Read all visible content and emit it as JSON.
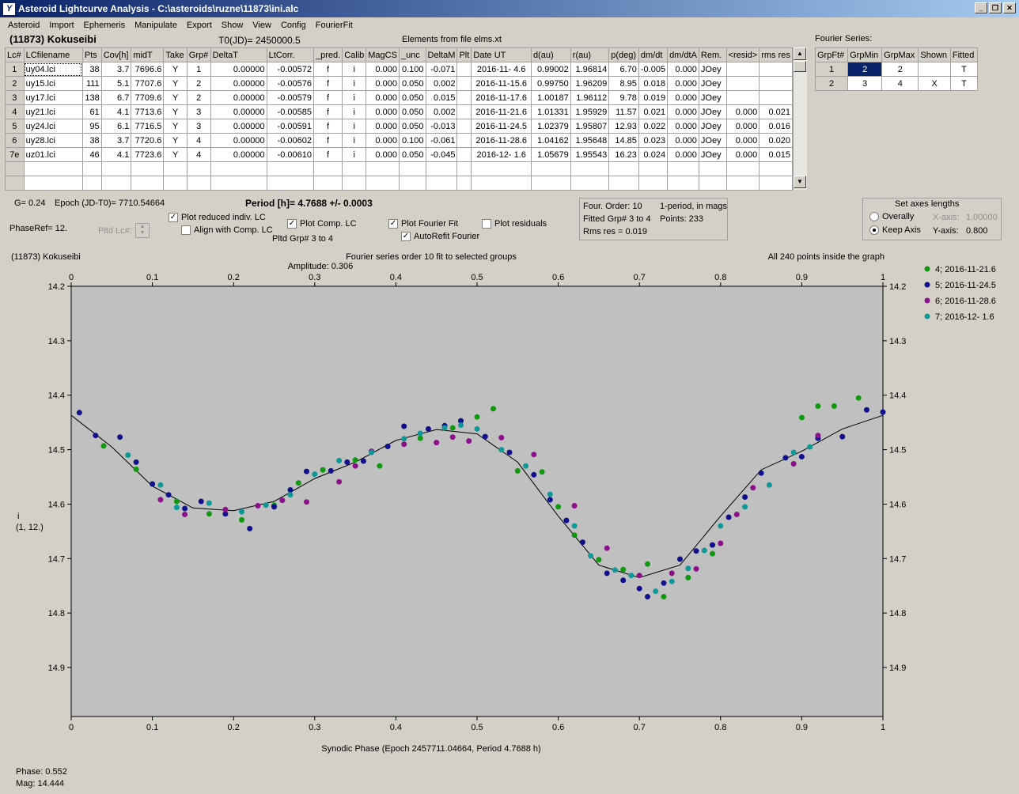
{
  "window": {
    "title": "Asteroid Lightcurve Analysis - C:\\asteroids\\ruzne\\11873\\ini.alc",
    "app_icon": "Y"
  },
  "window_controls": {
    "minimize": "_",
    "restore": "❐",
    "close": "✕"
  },
  "menu": [
    "Asteroid",
    "Import",
    "Ephemeris",
    "Manipulate",
    "Export",
    "Show",
    "View",
    "Config",
    "FourierFit"
  ],
  "header": {
    "asteroid": "(11873) Kokuseibi",
    "t0": "T0(JD)= 2450000.5",
    "elements": "Elements from file elms.xt"
  },
  "table": {
    "columns": [
      "Lc#",
      "LCfilename",
      "Pts",
      "Cov[h]",
      "midT",
      "Take",
      "Grp#",
      "DeltaT",
      "LtCorr.",
      "_pred.",
      "Calib",
      "MagCS",
      "_unc",
      "DeltaM",
      "Plt",
      "Date UT",
      "d(au)",
      "r(au)",
      "p(deg)",
      "dm/dt",
      "dm/dtA",
      "Rem.",
      "<resid>",
      "rms res"
    ],
    "rows": [
      [
        "1",
        "uy04.lci",
        "38",
        "3.7",
        "7696.6",
        "Y",
        "1",
        "0.00000",
        "-0.00572",
        "f",
        "i",
        "0.000",
        "0.100",
        "-0.071",
        "",
        "2016-11- 4.6",
        "0.99002",
        "1.96814",
        "6.70",
        "-0.005",
        "0.000",
        "JOey",
        "",
        ""
      ],
      [
        "2",
        "uy15.lci",
        "111",
        "5.1",
        "7707.6",
        "Y",
        "2",
        "0.00000",
        "-0.00576",
        "f",
        "i",
        "0.000",
        "0.050",
        "0.002",
        "",
        "2016-11-15.6",
        "0.99750",
        "1.96209",
        "8.95",
        "0.018",
        "0.000",
        "JOey",
        "",
        ""
      ],
      [
        "3",
        "uy17.lci",
        "138",
        "6.7",
        "7709.6",
        "Y",
        "2",
        "0.00000",
        "-0.00579",
        "f",
        "i",
        "0.000",
        "0.050",
        "0.015",
        "",
        "2016-11-17.6",
        "1.00187",
        "1.96112",
        "9.78",
        "0.019",
        "0.000",
        "JOey",
        "",
        ""
      ],
      [
        "4",
        "uy21.lci",
        "61",
        "4.1",
        "7713.6",
        "Y",
        "3",
        "0.00000",
        "-0.00585",
        "f",
        "i",
        "0.000",
        "0.050",
        "0.002",
        "",
        "2016-11-21.6",
        "1.01331",
        "1.95929",
        "11.57",
        "0.021",
        "0.000",
        "JOey",
        "0.000",
        "0.021"
      ],
      [
        "5",
        "uy24.lci",
        "95",
        "6.1",
        "7716.5",
        "Y",
        "3",
        "0.00000",
        "-0.00591",
        "f",
        "i",
        "0.000",
        "0.050",
        "-0.013",
        "",
        "2016-11-24.5",
        "1.02379",
        "1.95807",
        "12.93",
        "0.022",
        "0.000",
        "JOey",
        "0.000",
        "0.016"
      ],
      [
        "6",
        "uy28.lci",
        "38",
        "3.7",
        "7720.6",
        "Y",
        "4",
        "0.00000",
        "-0.00602",
        "f",
        "i",
        "0.000",
        "0.100",
        "-0.061",
        "",
        "2016-11-28.6",
        "1.04162",
        "1.95648",
        "14.85",
        "0.023",
        "0.000",
        "JOey",
        "0.000",
        "0.020"
      ],
      [
        "7e",
        "uz01.lci",
        "46",
        "4.1",
        "7723.6",
        "Y",
        "4",
        "0.00000",
        "-0.00610",
        "f",
        "i",
        "0.000",
        "0.050",
        "-0.045",
        "",
        "2016-12- 1.6",
        "1.05679",
        "1.95543",
        "16.23",
        "0.024",
        "0.000",
        "JOey",
        "0.000",
        "0.015"
      ]
    ]
  },
  "fourier_table": {
    "title": "Fourier Series:",
    "columns": [
      "GrpFt#",
      "GrpMin",
      "GrpMax",
      "Shown",
      "Fitted"
    ],
    "rows": [
      [
        "1",
        "2",
        "2",
        "",
        "T"
      ],
      [
        "2",
        "3",
        "4",
        "X",
        "T"
      ]
    ]
  },
  "controls": {
    "g": "G= 0.24",
    "epoch": "Epoch (JD-T0)= 7710.54664",
    "period": "Period [h]= 4.7688 +/- 0.0003",
    "phaseref": "PhaseRef= 12.",
    "pltd_lc": "Pltd Lc#:",
    "plot_reduced": "Plot reduced indiv. LC",
    "align_comp": "Align with Comp. LC",
    "plot_comp": "Plot Comp. LC",
    "pltd_grp": "Pltd Grp#  3  to  4",
    "plot_fourier": "Plot Fourier Fit",
    "autorefit": "AutoRefit Fourier",
    "plot_residuals": "Plot residuals",
    "check_mark": "✓"
  },
  "info_box": {
    "order": "Four. Order: 10",
    "period_mode": "1-period, in mags",
    "fitted": "Fitted Grp# 3 to 4",
    "points": "Points: 233",
    "rms": "Rms res     = 0.019"
  },
  "axes_box": {
    "title": "Set axes lengths",
    "overally": "Overally",
    "keep_axis": "Keep Axis",
    "x_axis_label": "X-axis:",
    "x_axis_value": "1.00000",
    "y_axis_label": "Y-axis:",
    "y_axis_value": "0.800"
  },
  "status": {
    "phase": "Phase:  0.552",
    "mag": "Mag:     14.444"
  },
  "chart_data": {
    "type": "scatter",
    "title": "Fourier series order 10 fit to selected groups",
    "subtitle": "Amplitude: 0.306",
    "object_label": "(11873) Kokuseibi",
    "note": "All 240 points inside the graph",
    "xlabel": "Synodic Phase (Epoch 2457711.04664, Period 4.7688 h)",
    "ylabel": "i",
    "ylabel2": "(1, 12.)",
    "xlim": [
      0.0,
      1.0
    ],
    "ylim": [
      14.2,
      14.99
    ],
    "y_inverted": true,
    "xticks": [
      0.0,
      0.1,
      0.2,
      0.3,
      0.4,
      0.5,
      0.6,
      0.7,
      0.8,
      0.9,
      1.0
    ],
    "yticks": [
      14.2,
      14.3,
      14.4,
      14.5,
      14.6,
      14.7,
      14.8,
      14.9
    ],
    "legend_position": "right",
    "fit_curve": {
      "x": [
        0.0,
        0.05,
        0.1,
        0.15,
        0.2,
        0.25,
        0.3,
        0.35,
        0.4,
        0.45,
        0.5,
        0.55,
        0.6,
        0.65,
        0.7,
        0.75,
        0.8,
        0.85,
        0.9,
        0.95,
        1.0
      ],
      "y": [
        14.437,
        14.495,
        14.567,
        14.607,
        14.612,
        14.595,
        14.553,
        14.523,
        14.483,
        14.463,
        14.471,
        14.523,
        14.622,
        14.712,
        14.735,
        14.712,
        14.622,
        14.537,
        14.503,
        14.462,
        14.437
      ],
      "color": "#000000"
    },
    "series": [
      {
        "name": "4; 2016-11-21.6",
        "color": "#109810",
        "x": [
          0.04,
          0.08,
          0.13,
          0.17,
          0.21,
          0.25,
          0.28,
          0.31,
          0.35,
          0.38,
          0.43,
          0.47,
          0.5,
          0.52,
          0.55,
          0.58,
          0.6,
          0.62,
          0.65,
          0.68,
          0.71,
          0.73,
          0.76,
          0.79,
          0.9,
          0.92,
          0.94,
          0.97
        ],
        "y": [
          14.493,
          14.536,
          14.595,
          14.618,
          14.629,
          14.602,
          14.561,
          14.537,
          14.519,
          14.53,
          14.479,
          14.46,
          14.44,
          14.425,
          14.539,
          14.541,
          14.605,
          14.657,
          14.702,
          14.72,
          14.71,
          14.77,
          14.735,
          14.691,
          14.441,
          14.42,
          14.42,
          14.405
        ]
      },
      {
        "name": "5; 2016-11-24.5",
        "color": "#10108c",
        "x": [
          0.01,
          0.03,
          0.06,
          0.08,
          0.1,
          0.12,
          0.14,
          0.16,
          0.19,
          0.22,
          0.25,
          0.27,
          0.29,
          0.32,
          0.34,
          0.36,
          0.39,
          0.41,
          0.44,
          0.46,
          0.48,
          0.51,
          0.54,
          0.57,
          0.59,
          0.61,
          0.63,
          0.66,
          0.68,
          0.7,
          0.71,
          0.73,
          0.75,
          0.77,
          0.79,
          0.81,
          0.83,
          0.85,
          0.88,
          0.9,
          0.92,
          0.95,
          0.98,
          1.0
        ],
        "y": [
          14.432,
          14.474,
          14.477,
          14.523,
          14.563,
          14.583,
          14.608,
          14.595,
          14.618,
          14.645,
          14.605,
          14.574,
          14.54,
          14.539,
          14.523,
          14.521,
          14.494,
          14.457,
          14.462,
          14.456,
          14.447,
          14.476,
          14.505,
          14.546,
          14.592,
          14.63,
          14.67,
          14.727,
          14.74,
          14.755,
          14.77,
          14.745,
          14.701,
          14.686,
          14.675,
          14.624,
          14.587,
          14.543,
          14.515,
          14.513,
          14.479,
          14.476,
          14.427,
          14.431
        ]
      },
      {
        "name": "6; 2016-11-28.6",
        "color": "#8c108c",
        "x": [
          0.11,
          0.14,
          0.19,
          0.23,
          0.26,
          0.29,
          0.33,
          0.35,
          0.37,
          0.41,
          0.45,
          0.47,
          0.49,
          0.53,
          0.57,
          0.62,
          0.66,
          0.7,
          0.74,
          0.77,
          0.8,
          0.82,
          0.84,
          0.89,
          0.92
        ],
        "y": [
          14.592,
          14.619,
          14.61,
          14.603,
          14.593,
          14.596,
          14.559,
          14.53,
          14.503,
          14.49,
          14.487,
          14.477,
          14.484,
          14.478,
          14.509,
          14.603,
          14.681,
          14.731,
          14.727,
          14.719,
          14.672,
          14.619,
          14.57,
          14.526,
          14.474
        ]
      },
      {
        "name": "7; 2016-12- 1.6",
        "color": "#109898",
        "x": [
          0.07,
          0.11,
          0.13,
          0.17,
          0.21,
          0.24,
          0.27,
          0.3,
          0.33,
          0.37,
          0.41,
          0.43,
          0.46,
          0.48,
          0.5,
          0.53,
          0.56,
          0.59,
          0.62,
          0.64,
          0.67,
          0.69,
          0.72,
          0.74,
          0.76,
          0.78,
          0.8,
          0.83,
          0.86,
          0.89,
          0.91
        ],
        "y": [
          14.51,
          14.565,
          14.606,
          14.598,
          14.614,
          14.602,
          14.583,
          14.545,
          14.52,
          14.505,
          14.48,
          14.47,
          14.46,
          14.455,
          14.462,
          14.5,
          14.53,
          14.582,
          14.64,
          14.695,
          14.721,
          14.731,
          14.76,
          14.742,
          14.718,
          14.685,
          14.64,
          14.605,
          14.565,
          14.505,
          14.495
        ]
      }
    ]
  }
}
